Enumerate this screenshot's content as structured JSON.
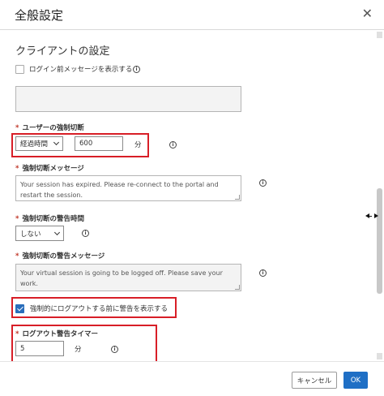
{
  "dialog": {
    "title": "全般設定",
    "close_glyph": "✕"
  },
  "section": {
    "title": "クライアントの設定"
  },
  "login_message": {
    "checkbox_label": "ログイン前メッセージを表示する",
    "checked": false,
    "text": ""
  },
  "force_disconnect": {
    "label": "ユーザーの強制切断",
    "required_mark": "*",
    "select_value": "経過時間",
    "input_value": "600",
    "unit": "分"
  },
  "disconnect_message": {
    "label": "強制切断メッセージ",
    "required_mark": "*",
    "text": "Your session has expired. Please re-connect to the portal and restart the session."
  },
  "warning_time": {
    "label": "強制切断の警告時間",
    "required_mark": "*",
    "select_value": "しない"
  },
  "warning_message": {
    "label": "強制切断の警告メッセージ",
    "required_mark": "*",
    "text": "Your virtual session is going to be logged off. Please save your work."
  },
  "logout_warning": {
    "checkbox_label": "強制的にログアウトする前に警告を表示する",
    "checked": true
  },
  "logout_timer": {
    "label": "ログアウト警告タイマー",
    "required_mark": "*",
    "input_value": "5",
    "unit": "分"
  },
  "info_glyph": "i",
  "footer": {
    "cancel_label": "キャンセル",
    "ok_label": "OK"
  },
  "colors": {
    "highlight": "#d81e27",
    "primary": "#1f6fc5",
    "checkbox_checked": "#2a6ebb"
  }
}
